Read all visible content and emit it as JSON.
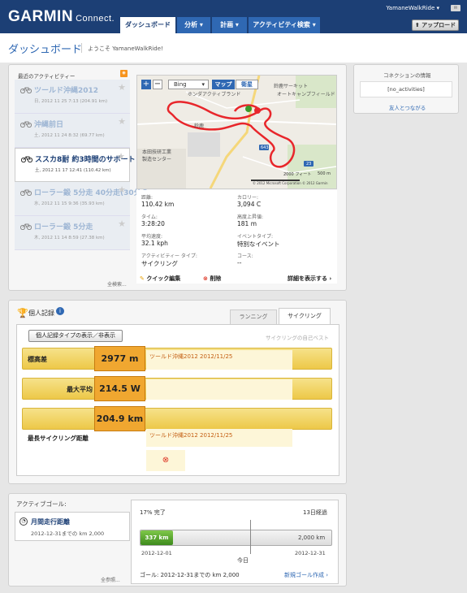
{
  "header": {
    "logo_main": "GARMIN",
    "logo_sub": "Connect.",
    "tabs": [
      {
        "label": "ダッシュボード",
        "active": true
      },
      {
        "label": "分析 ▾",
        "active": false
      },
      {
        "label": "計画 ▾",
        "active": false
      },
      {
        "label": "アクティビティ検索 ▾",
        "active": false
      }
    ],
    "user": "YamaneWalkRide ▾",
    "mail": "✉",
    "upload_label": "⬆ アップロード"
  },
  "page": {
    "title": "ダッシュボード",
    "welcome": "ようこそ YamaneWalkRide!"
  },
  "recent": {
    "heading": "最近のアクティビティー",
    "rss": "RSS",
    "activities": [
      {
        "title": "ツールド沖縄2012",
        "date": "日, 2012 11 25 7:13 (204.91 km)"
      },
      {
        "title": "沖縄前日",
        "date": "土, 2012 11 24 8:32 (69.77 km)"
      },
      {
        "title": "ススカ8耐 約3時間のサポート",
        "date": "土, 2012 11 17 12:41 (110.42 km)"
      },
      {
        "title": "ローラー鍛 5分走 40分走(30分の",
        "date": "水, 2012 11 15 9:36 (35.93 km)"
      },
      {
        "title": "ローラー鍛 5分走",
        "date": "木, 2012 11 14 8:59 (27.38 km)"
      }
    ],
    "see_all": "全検索..."
  },
  "map": {
    "provider": "Bing",
    "type_map": "マップ",
    "type_aerial": "衛星",
    "labels": [
      "鈴鹿サーキット",
      "オートキャンプフィールド",
      "ホンダアクティブランド",
      "本田技研工業",
      "製造センター",
      "鈴鹿",
      "643",
      "23",
      "白子町",
      "鈴鹿市",
      "サーキット道路"
    ],
    "scale": "2000 フィート",
    "scale2": "500 m",
    "copyright": "© 2012 Microsoft Corporation © 2012 Garmin",
    "zoom_in": "+",
    "zoom_out": "−"
  },
  "details": {
    "stats": [
      {
        "label": "距離:",
        "value": "110.42 km"
      },
      {
        "label": "カロリー:",
        "value": "3,094 C"
      },
      {
        "label": "タイム:",
        "value": "3:28:20"
      },
      {
        "label": "高度上昇値:",
        "value": "181 m"
      },
      {
        "label": "平均速度:",
        "value": "32.1 kph"
      },
      {
        "label": "イベントタイプ:",
        "value": "特別なイベント"
      },
      {
        "label": "アクティビティー タイプ:",
        "value": "サイクリング"
      },
      {
        "label": "コース:",
        "value": "--"
      }
    ],
    "quick_edit": "クイック編集",
    "delete": "削除",
    "show_detail": "詳細を表示する ›"
  },
  "connections": {
    "heading": "コネクションの情報",
    "value": "[no_activities]",
    "link": "友人とつながる"
  },
  "records": {
    "heading": "個人記録",
    "tab_running": "ランニング",
    "tab_cycling": "サイクリング",
    "toggle_label": "個人記録タイプの表示／非表示",
    "best_label": "サイクリングの自己ベスト",
    "items": [
      {
        "name": "標高差",
        "value": "2977 m",
        "desc": "ツールド沖縄2012  2012/11/25"
      },
      {
        "name": "最大平均",
        "value": "214.5 W",
        "desc": ""
      },
      {
        "name": "最長サイクリング距離",
        "value": "204.9 km",
        "desc": "ツールド沖縄2012  2012/11/25"
      }
    ]
  },
  "goals": {
    "heading": "アクティブゴール:",
    "goal_title": "月間走行距離",
    "goal_sub": "2012-12-31までの km 2,000",
    "progress_label": "17% 完了",
    "elapsed_label": "13日経過",
    "progress_fraction": 0.17,
    "current_value": "337 km",
    "target_value": "2,000 km",
    "start_date": "2012-12-01",
    "end_date": "2012-12-31",
    "today_label": "今日",
    "footer": "ゴール: 2012-12-31までの km 2,000",
    "new_goal": "新規ゴール作成 ›",
    "see_all": "全参照..."
  }
}
